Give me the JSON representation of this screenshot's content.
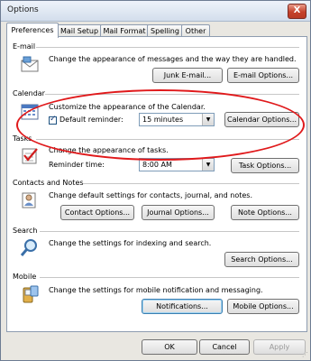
{
  "window": {
    "title": "Options",
    "close_label": "X"
  },
  "tabs": [
    {
      "label": "Preferences"
    },
    {
      "label": "Mail Setup"
    },
    {
      "label": "Mail Format"
    },
    {
      "label": "Spelling"
    },
    {
      "label": "Other"
    }
  ],
  "email": {
    "heading": "E-mail",
    "description": "Change the appearance of messages and the way they are handled.",
    "junk_button": "Junk E-mail...",
    "options_button": "E-mail Options..."
  },
  "calendar": {
    "heading": "Calendar",
    "description": "Customize the appearance of the Calendar.",
    "reminder_label": "Default reminder:",
    "reminder_checked": true,
    "reminder_value": "15 minutes",
    "options_button": "Calendar Options..."
  },
  "tasks": {
    "heading": "Tasks",
    "description": "Change the appearance of tasks.",
    "reminder_time_label": "Reminder time:",
    "reminder_time_value": "8:00 AM",
    "options_button": "Task Options..."
  },
  "contacts": {
    "heading": "Contacts and Notes",
    "description": "Change default settings for contacts, journal, and notes.",
    "contact_button": "Contact Options...",
    "journal_button": "Journal Options...",
    "note_button": "Note Options..."
  },
  "search": {
    "heading": "Search",
    "description": "Change the settings for indexing and search.",
    "options_button": "Search Options..."
  },
  "mobile": {
    "heading": "Mobile",
    "description": "Change the settings for mobile notification and messaging.",
    "notifications_button": "Notifications...",
    "options_button": "Mobile Options..."
  },
  "footer": {
    "ok": "OK",
    "cancel": "Cancel",
    "apply": "Apply"
  },
  "colors": {
    "highlight_ellipse": "#e0191b",
    "accent": "#3c7fb1"
  }
}
